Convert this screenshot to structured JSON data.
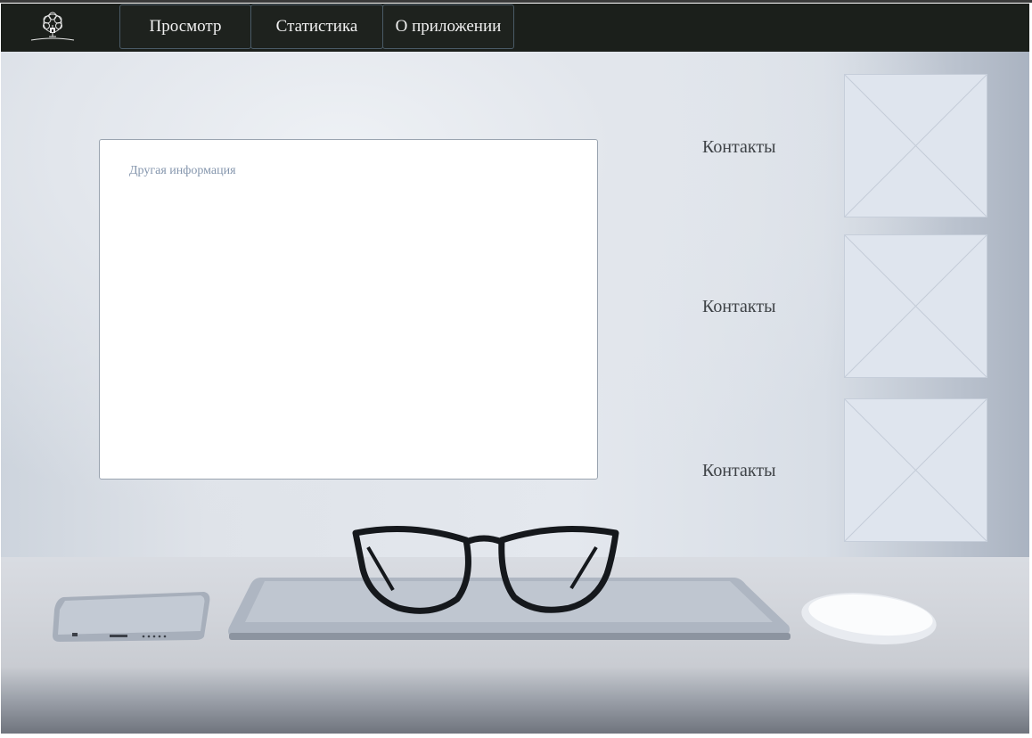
{
  "nav": {
    "logo_alt": "Tececopia",
    "items": [
      {
        "label": "Просмотр"
      },
      {
        "label": "Статистика"
      },
      {
        "label": "О приложении"
      }
    ]
  },
  "main": {
    "info_placeholder": "Другая информация",
    "contacts": [
      {
        "label": "Контакты"
      },
      {
        "label": "Контакты"
      },
      {
        "label": "Контакты"
      }
    ]
  },
  "colors": {
    "navbar": "#1b1f1b",
    "nav_border": "#4a5a66",
    "info_text": "#8596ad",
    "placeholder_bg": "#dfe5ee"
  }
}
